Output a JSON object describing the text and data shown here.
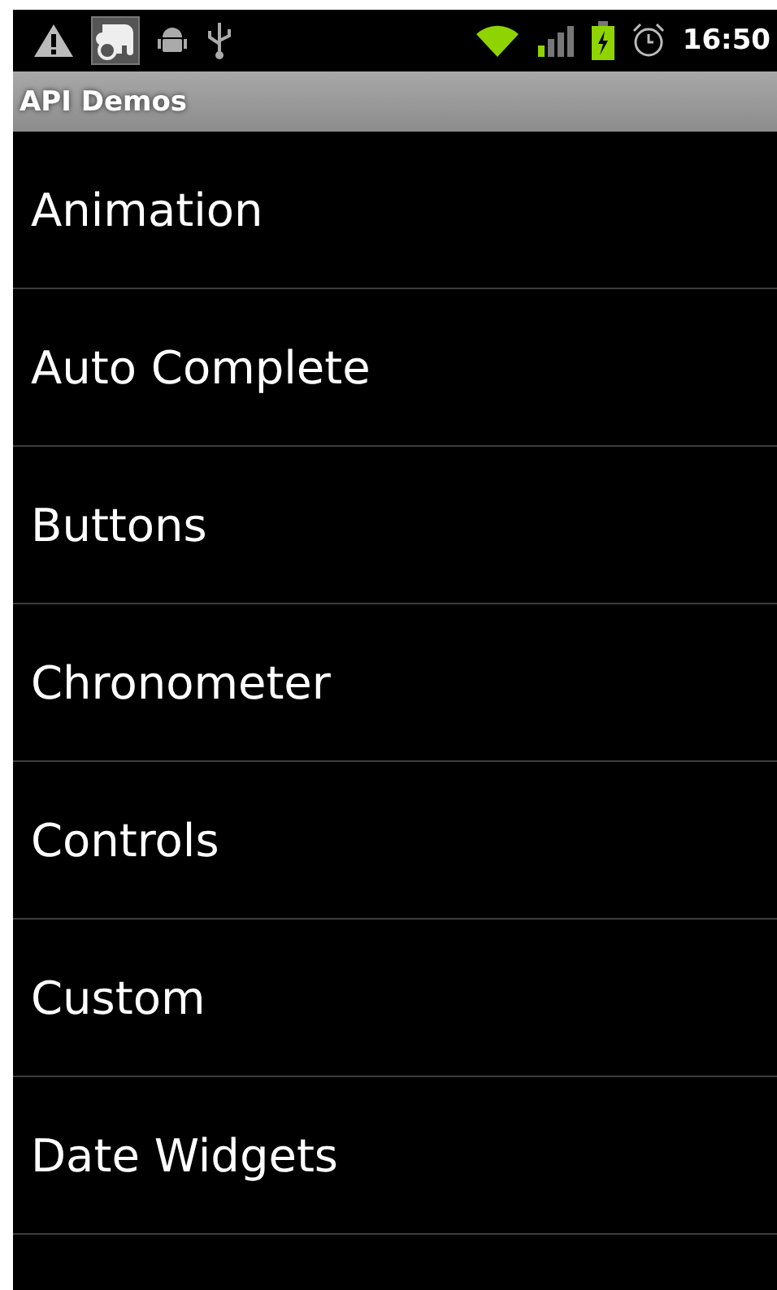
{
  "status_bar": {
    "time": "16:50"
  },
  "title_bar": {
    "title": "API Demos"
  },
  "list": {
    "items": [
      {
        "label": "Animation"
      },
      {
        "label": "Auto Complete"
      },
      {
        "label": "Buttons"
      },
      {
        "label": "Chronometer"
      },
      {
        "label": "Controls"
      },
      {
        "label": "Custom"
      },
      {
        "label": "Date Widgets"
      }
    ]
  }
}
